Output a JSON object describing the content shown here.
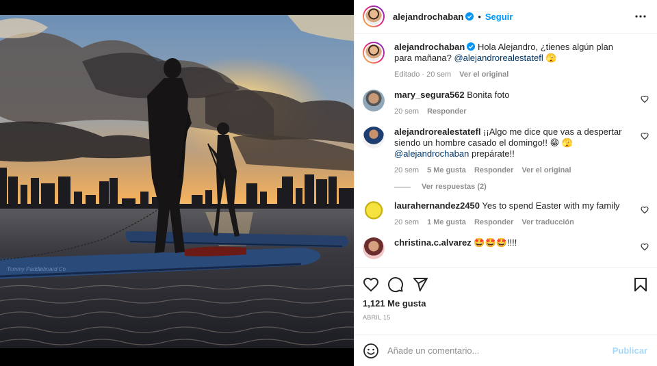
{
  "post": {
    "author": "alejandrochaban",
    "follow_label": "Seguir",
    "separator": "•",
    "image_watermark": "Tommy Paddleboard Co"
  },
  "caption": {
    "username": "alejandrochaban",
    "text": "Hola Alejandro, ¿tienes algún plan para mañana?",
    "mention": "@alejandrorealestatefl",
    "emoji": "🫣",
    "meta_edited": "Editado · 20 sem",
    "meta_original": "Ver el original"
  },
  "comments": [
    {
      "username": "mary_segura562",
      "text": "Bonita foto",
      "time": "20 sem",
      "reply": "Responder"
    },
    {
      "username": "alejandrorealestatefl",
      "text": "¡¡Algo me dice que vas a despertar siendo un hombre casado el domingo!! 😁 🫣",
      "mention": "@alejandrochaban",
      "text_after": "prepárate!!",
      "time": "20 sem",
      "likes": "5 Me gusta",
      "reply": "Responder",
      "original": "Ver el original",
      "view_replies": "Ver respuestas (2)"
    },
    {
      "username": "laurahernandez2450",
      "text": "Yes to spend Easter with my family",
      "time": "20 sem",
      "likes": "1 Me gusta",
      "reply": "Responder",
      "translate": "Ver traducción"
    },
    {
      "username": "christina.c.alvarez",
      "text": "🤩🤩🤩!!!!"
    }
  ],
  "actions": {
    "likes_count": "1,121 Me gusta",
    "date": "ABRIL 15"
  },
  "add_comment": {
    "placeholder": "Añade un comentario...",
    "publish_label": "Publicar"
  },
  "colors": {
    "accent": "#0095f6",
    "text": "#262626",
    "muted": "#8e8e8e",
    "mention": "#00376b"
  }
}
